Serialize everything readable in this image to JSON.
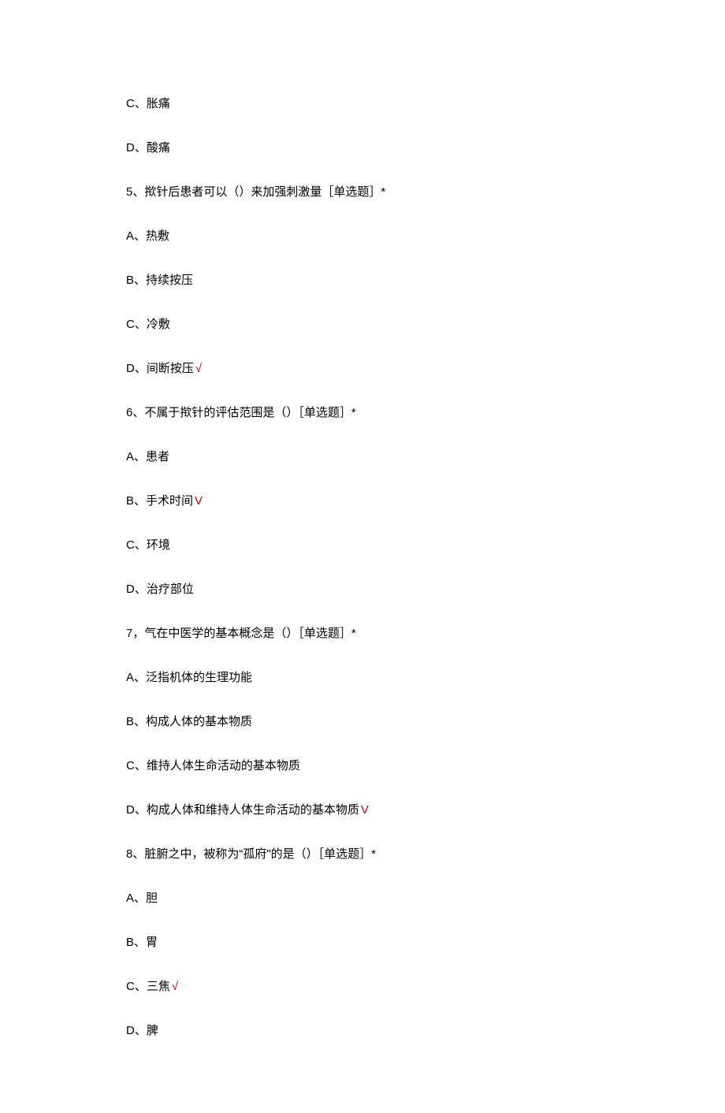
{
  "lines": [
    {
      "text": "C、胀痛",
      "correct": false
    },
    {
      "text": "D、酸痛",
      "correct": false
    },
    {
      "text": "5、揿针后患者可以（）来加强刺激量［单选题］*",
      "correct": false
    },
    {
      "text": "A、热敷",
      "correct": false
    },
    {
      "text": "B、持续按压",
      "correct": false
    },
    {
      "text": "C、冷敷",
      "correct": false
    },
    {
      "text": "D、间断按压",
      "correct": true,
      "mark": "√"
    },
    {
      "text": "6、不属于揿针的评估范围是（）［单选题］*",
      "correct": false
    },
    {
      "text": "A、患者",
      "correct": false
    },
    {
      "text": "B、手术时间",
      "correct": true,
      "mark": "V"
    },
    {
      "text": "C、环境",
      "correct": false
    },
    {
      "text": "D、治疗部位",
      "correct": false
    },
    {
      "text": "7，气在中医学的基本概念是（）［单选题］*",
      "correct": false
    },
    {
      "text": "A、泛指机体的生理功能",
      "correct": false
    },
    {
      "text": "B、构成人体的基本物质",
      "correct": false
    },
    {
      "text": "C、维持人体生命活动的基本物质",
      "correct": false
    },
    {
      "text": "D、构成人体和维持人体生命活动的基本物质",
      "correct": true,
      "mark": "V"
    },
    {
      "text": "8、脏腑之中，被称为“孤府\"的是（）［单选题］*",
      "correct": false
    },
    {
      "text": "A、胆",
      "correct": false
    },
    {
      "text": "B、胃",
      "correct": false
    },
    {
      "text": "C、三焦",
      "correct": true,
      "mark": "√"
    },
    {
      "text": "D、脾",
      "correct": false
    }
  ]
}
